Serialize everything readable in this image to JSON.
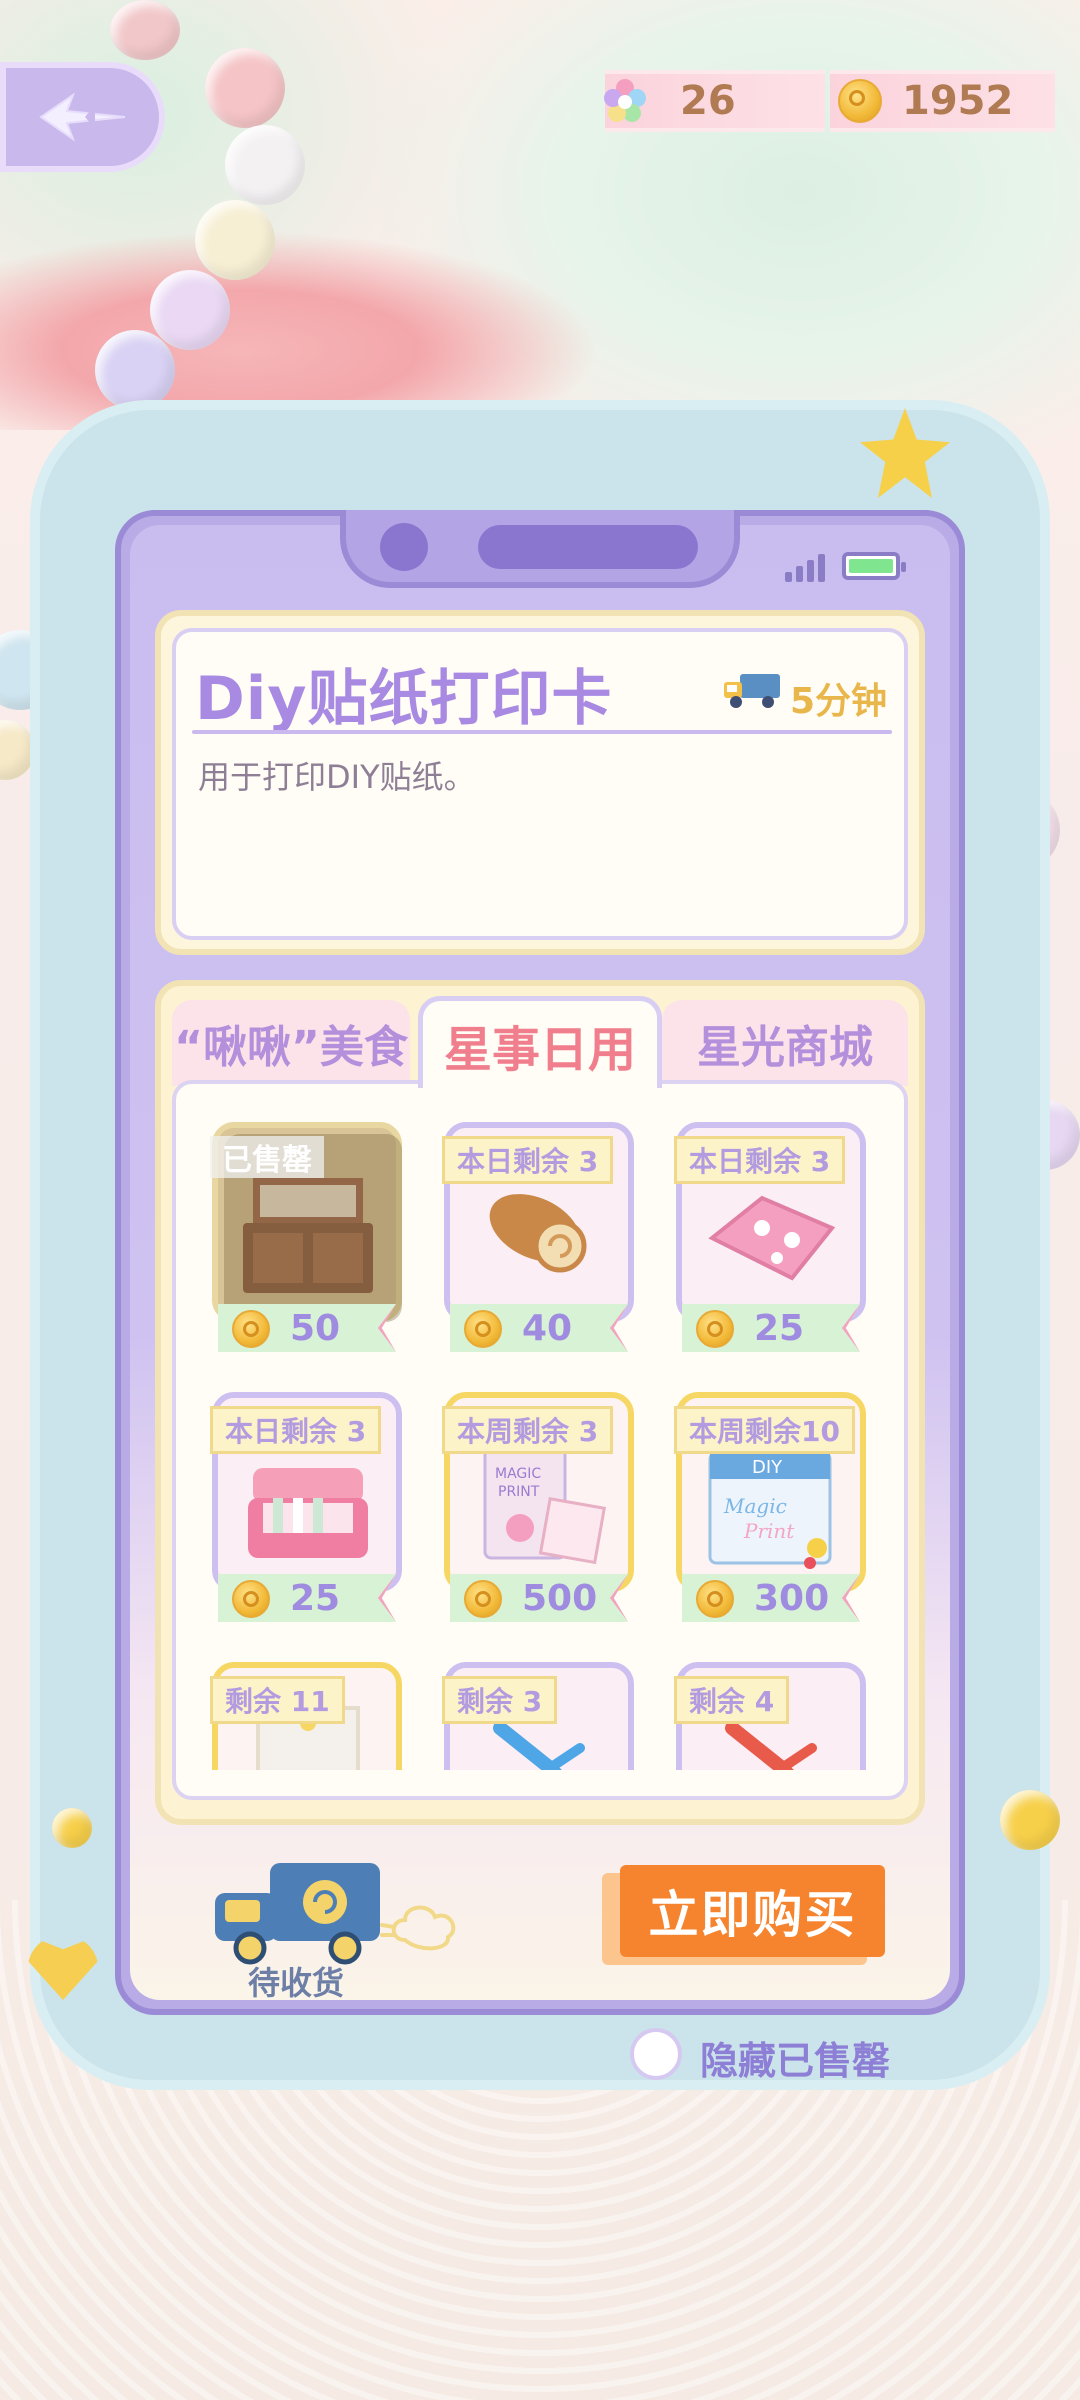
{
  "resources": {
    "stars": "26",
    "coins": "1952"
  },
  "item_info": {
    "title": "Diy贴纸打印卡",
    "delivery_time": "5分钟",
    "description": "用于打印DIY贴纸。"
  },
  "tabs": [
    {
      "label": "“啾啾”美食",
      "active": false
    },
    {
      "label": "星事日用",
      "active": true
    },
    {
      "label": "星光商城",
      "active": false
    }
  ],
  "items": [
    {
      "tag": "已售罄",
      "price": "50",
      "name": "cabinet",
      "sold_out": true
    },
    {
      "tag": "本日剩余 3",
      "price": "40",
      "name": "roll-cake",
      "sold_out": false
    },
    {
      "tag": "本日剩余 3",
      "price": "25",
      "name": "pink-towel",
      "sold_out": false
    },
    {
      "tag": "本日剩余 3",
      "price": "25",
      "name": "pink-case",
      "sold_out": false
    },
    {
      "tag": "本周剩余 3",
      "price": "500",
      "name": "magic-print-book",
      "sold_out": false
    },
    {
      "tag": "本周剩余10",
      "price": "300",
      "name": "diy-magic-print",
      "sold_out": false
    },
    {
      "tag": "剩余 11",
      "price": "",
      "name": "frame",
      "sold_out": false
    },
    {
      "tag": "剩余 3",
      "price": "",
      "name": "blue-scissors",
      "sold_out": false
    },
    {
      "tag": "剩余 4",
      "price": "",
      "name": "red-scissors",
      "sold_out": false
    }
  ],
  "bottom": {
    "pending_label": "待收货",
    "buy_label": "立即购买",
    "hide_sold_label": "隐藏已售罄"
  },
  "colors": {
    "accent_purple": "#a98ae2",
    "active_tab": "#f07e8d",
    "buy_button": "#f6842f",
    "price_bg": "#d8f2d6"
  }
}
